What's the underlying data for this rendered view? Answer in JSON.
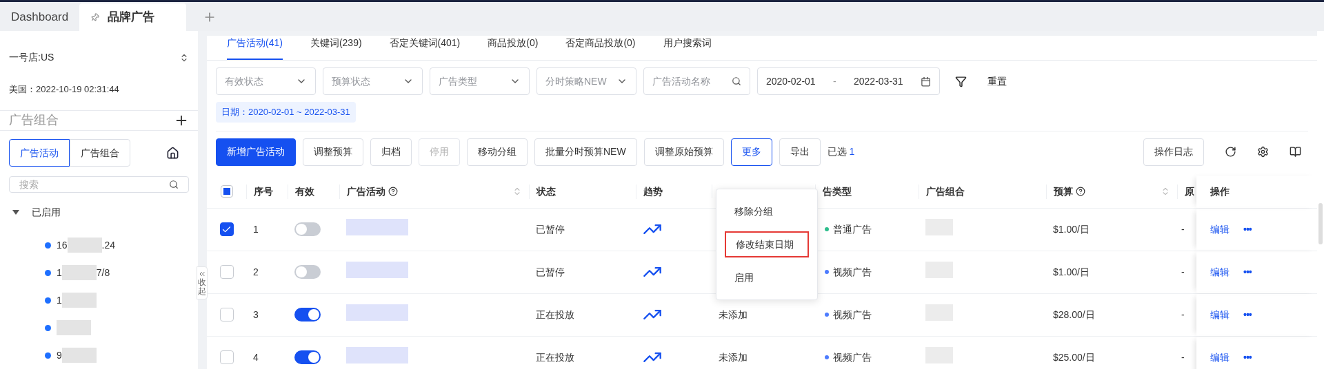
{
  "window_tabs": [
    {
      "label": "Dashboard",
      "selected": false,
      "pinned": false
    },
    {
      "label": "品牌广告",
      "selected": true,
      "pinned": true
    }
  ],
  "sidebar": {
    "store": "一号店:US",
    "time": "美国：2022-10-19 02:31:44",
    "section_title": "广告组合",
    "view_toggle": [
      {
        "label": "广告活动",
        "selected": true
      },
      {
        "label": "广告组合",
        "selected": false
      }
    ],
    "search": {
      "placeholder": "搜索"
    },
    "tree": [
      {
        "label": "已启用",
        "expanded": true,
        "children": [
          {
            "prefix": "16",
            "suffix": ".24",
            "redacted": true
          },
          {
            "prefix": "1",
            "suffix": "7/8",
            "redacted": true
          },
          {
            "prefix": "1",
            "redacted": true
          },
          {
            "redacted": true
          },
          {
            "prefix": "9",
            "redacted": true
          }
        ]
      }
    ]
  },
  "collapse_handle": {
    "label": "收起"
  },
  "main_tabs": [
    {
      "label": "广告活动(41)",
      "selected": true
    },
    {
      "label": "关键词(239)",
      "selected": false
    },
    {
      "label": "否定关键词(401)",
      "selected": false
    },
    {
      "label": "商品投放(0)",
      "selected": false
    },
    {
      "label": "否定商品投放(0)",
      "selected": false
    },
    {
      "label": "用户搜索词",
      "selected": false
    }
  ],
  "filters": [
    {
      "kind": "select",
      "placeholder": "有效状态"
    },
    {
      "kind": "select",
      "placeholder": "预算状态"
    },
    {
      "kind": "select",
      "placeholder": "广告类型"
    },
    {
      "kind": "select",
      "placeholder": "分时策略NEW"
    },
    {
      "kind": "search",
      "placeholder": "广告活动名称"
    },
    {
      "kind": "daterange",
      "start": "2020-02-01",
      "separator": "-",
      "end": "2022-03-31"
    }
  ],
  "reset_link": "重置",
  "date_tag": "日期：2020-02-01 ~ 2022-03-31",
  "toolbar": {
    "buttons": [
      {
        "label": "新增广告活动",
        "kind": "primary"
      },
      {
        "label": "调整预算",
        "kind": "default"
      },
      {
        "label": "归档",
        "kind": "default"
      },
      {
        "label": "停用",
        "kind": "disabled"
      },
      {
        "label": "移动分组",
        "kind": "default"
      },
      {
        "label": "批量分时预算NEW",
        "kind": "default"
      },
      {
        "label": "调整原始预算",
        "kind": "default"
      },
      {
        "label": "更多",
        "kind": "active"
      },
      {
        "label": "导出",
        "kind": "default"
      }
    ],
    "selected_label": "已选",
    "selected_count": "1",
    "log_button": "操作日志"
  },
  "more_menu": [
    {
      "label": "移除分组",
      "marked": false
    },
    {
      "label": "修改结束日期",
      "marked": true
    },
    {
      "label": "启用",
      "marked": false
    }
  ],
  "table": {
    "select_all": {
      "indeterminate": true
    },
    "columns": [
      {
        "label": "序号"
      },
      {
        "label": "有效"
      },
      {
        "label": "广告活动",
        "help": true,
        "sortable": true
      },
      {
        "label": "状态"
      },
      {
        "label": "趋势"
      },
      {
        "label": "告类型"
      },
      {
        "label": "广告组合"
      },
      {
        "label": "预算",
        "help": true,
        "sortable": true
      },
      {
        "label": "原"
      },
      {
        "label": "操作"
      }
    ],
    "rows": [
      {
        "selected": true,
        "index": "1",
        "enabled": false,
        "status": "已暂停",
        "type": "普通广告",
        "color": "#2dbd8c",
        "budget": "$1.00/日",
        "column_10": "-",
        "edit": "编辑",
        "more": "•••"
      },
      {
        "selected": false,
        "index": "2",
        "enabled": false,
        "status": "已暂停",
        "type": "视频广告",
        "color": "#4d7cfe",
        "budget": "$1.00/日",
        "column_10": "-",
        "edit": "编辑",
        "more": "•••"
      },
      {
        "selected": false,
        "index": "3",
        "enabled": true,
        "status": "正在投放",
        "column_7": "未添加",
        "type": "视频广告",
        "color": "#4d7cfe",
        "budget": "$28.00/日",
        "column_10": "-",
        "edit": "编辑",
        "more": "•••"
      },
      {
        "selected": false,
        "index": "4",
        "enabled": true,
        "status": "正在投放",
        "column_7": "未添加",
        "type": "视频广告",
        "color": "#4d7cfe",
        "budget": "$25.00/日",
        "column_10": "-",
        "edit": "编辑",
        "more": "•••"
      }
    ]
  }
}
